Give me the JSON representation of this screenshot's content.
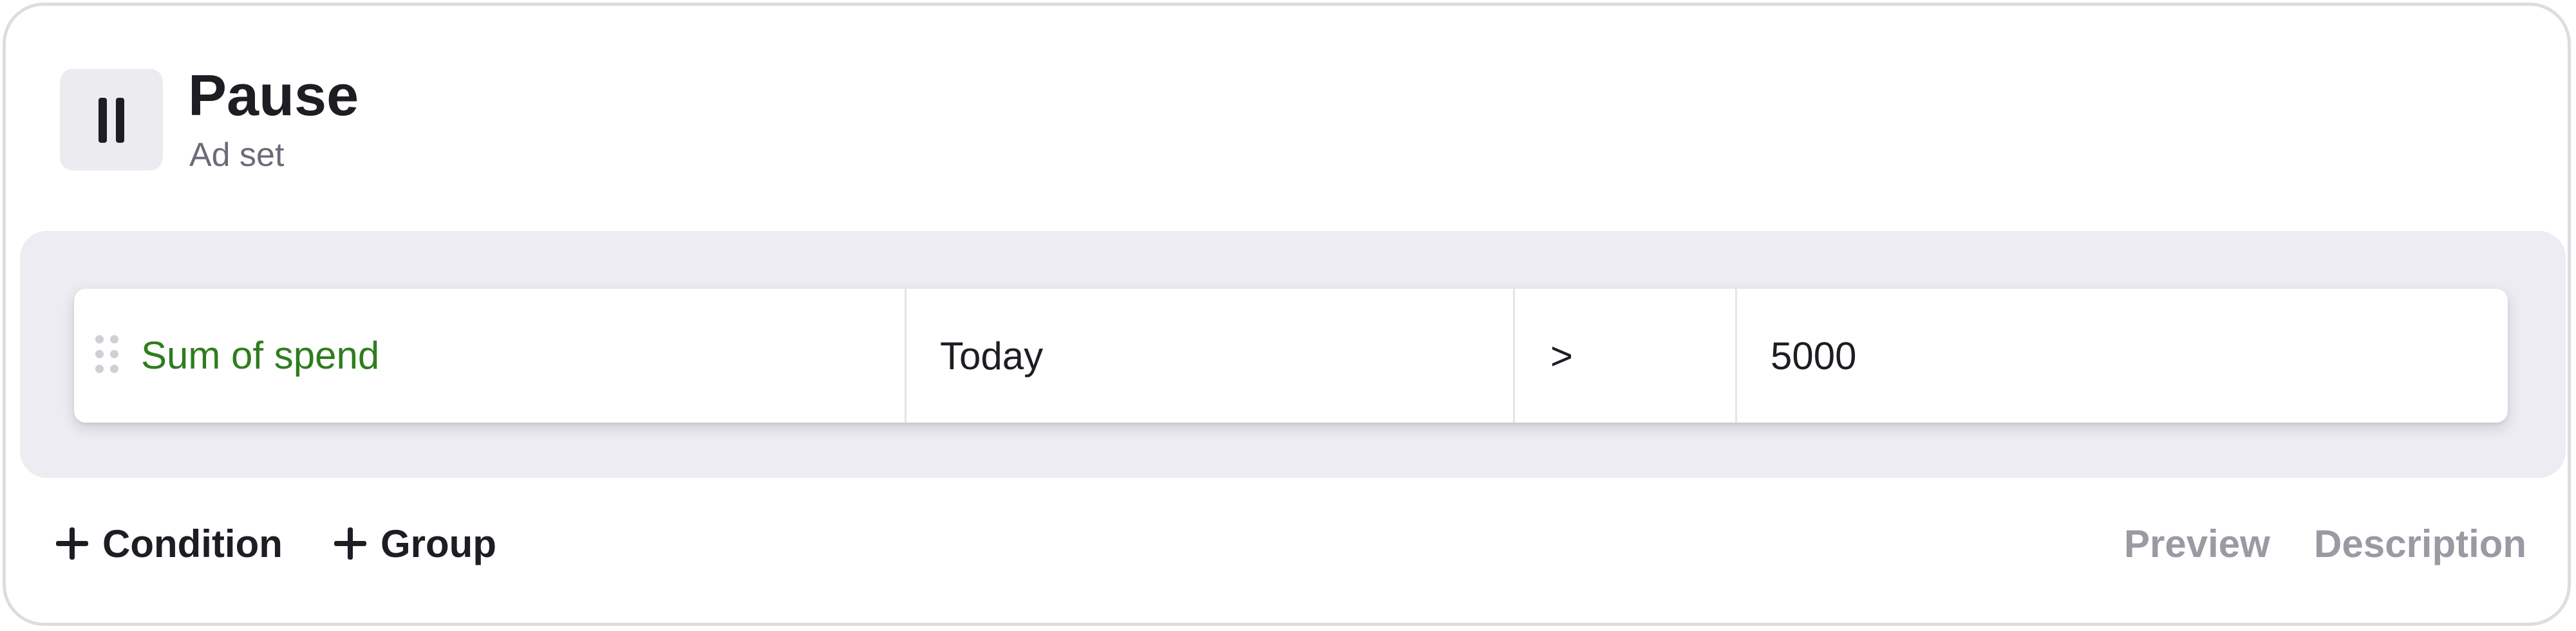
{
  "action": {
    "title": "Pause",
    "subtitle": "Ad set",
    "icon": "pause-icon"
  },
  "rule": {
    "metric": "Sum of spend",
    "period": "Today",
    "operator": ">",
    "value": "5000"
  },
  "footer": {
    "add_condition_label": "Condition",
    "add_group_label": "Group",
    "preview_label": "Preview",
    "description_label": "Description"
  },
  "colors": {
    "metric_text": "#2e7d1e",
    "muted_link": "#9a9aa2",
    "panel_bg": "#ececf2"
  }
}
